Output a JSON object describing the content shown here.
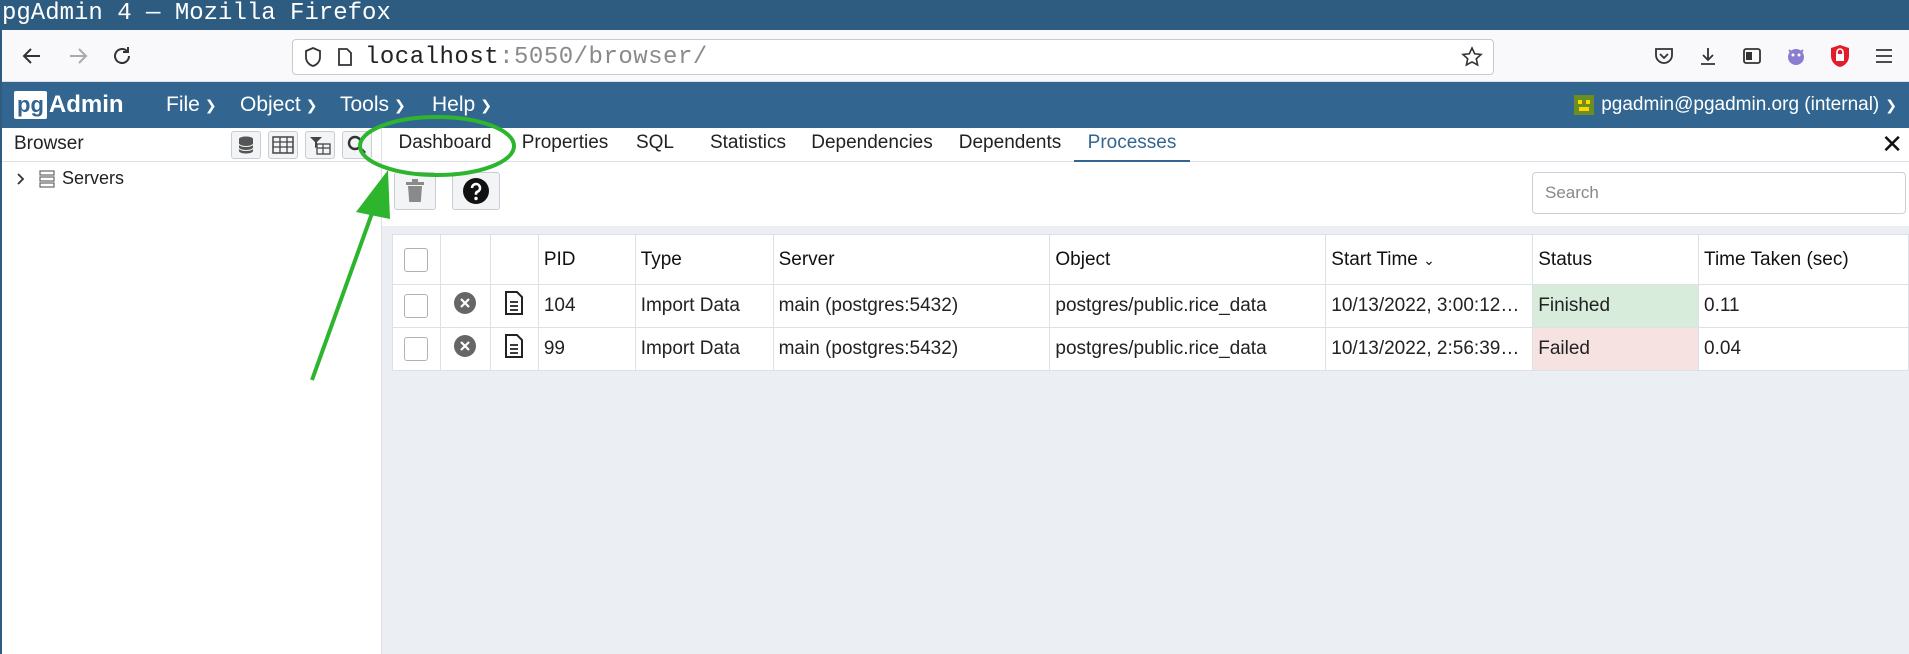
{
  "window": {
    "title": "pgAdmin 4 — Mozilla Firefox"
  },
  "browser": {
    "url_host": "localhost",
    "url_rest": ":5050/browser/",
    "icons": [
      "back-arrow-icon",
      "forward-arrow-icon",
      "reload-icon",
      "shield-icon",
      "page-icon",
      "star-icon",
      "pocket-icon",
      "download-icon",
      "reader-icon",
      "extension-icon",
      "ublock-icon",
      "menu-icon"
    ]
  },
  "app": {
    "logo_pg": "pg",
    "logo_admin": "Admin",
    "menus": [
      "File",
      "Object",
      "Tools",
      "Help"
    ],
    "user": "pgadmin@pgadmin.org (internal)"
  },
  "browser_panel": {
    "title": "Browser",
    "tree": {
      "label": "Servers"
    }
  },
  "tabs": [
    "Dashboard",
    "Properties",
    "SQL",
    "Statistics",
    "Dependencies",
    "Dependents",
    "Processes"
  ],
  "active_tab": "Processes",
  "processes": {
    "search_placeholder": "Search",
    "columns": [
      "PID",
      "Type",
      "Server",
      "Object",
      "Start Time",
      "Status",
      "Time Taken (sec)"
    ],
    "rows": [
      {
        "pid": "104",
        "type": "Import Data",
        "server": "main (postgres:5432)",
        "object": "postgres/public.rice_data",
        "start": "10/13/2022, 3:00:12…",
        "status": "Finished",
        "time": "0.11"
      },
      {
        "pid": "99",
        "type": "Import Data",
        "server": "main (postgres:5432)",
        "object": "postgres/public.rice_data",
        "start": "10/13/2022, 2:56:39…",
        "status": "Failed",
        "time": "0.04"
      }
    ]
  },
  "colors": {
    "app_header": "#326690",
    "finished_bg": "#d7ecda",
    "failed_bg": "#f7e2e2",
    "annotation": "#2db52d"
  }
}
